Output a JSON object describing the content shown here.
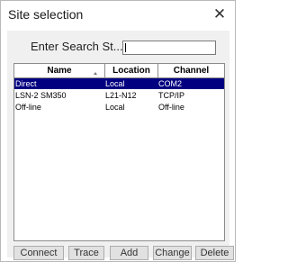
{
  "window": {
    "title": "Site selection",
    "close_glyph": "✕"
  },
  "search": {
    "label": "Enter Search St...",
    "value": ""
  },
  "grid": {
    "columns": [
      "Name",
      "Location",
      "Channel"
    ],
    "sort_column": "Name",
    "rows": [
      {
        "name": "Direct",
        "location": "Local",
        "channel": "COM2",
        "selected": true
      },
      {
        "name": "LSN-2 SM350",
        "location": "L21-N12",
        "channel": "TCP/IP",
        "selected": false
      },
      {
        "name": "Off-line",
        "location": "Local",
        "channel": "Off-line",
        "selected": false
      }
    ],
    "selection_color": "#000080"
  },
  "buttons": {
    "connect": "Connect",
    "trace": "Trace",
    "add": "Add",
    "change": "Change",
    "delete": "Delete"
  }
}
